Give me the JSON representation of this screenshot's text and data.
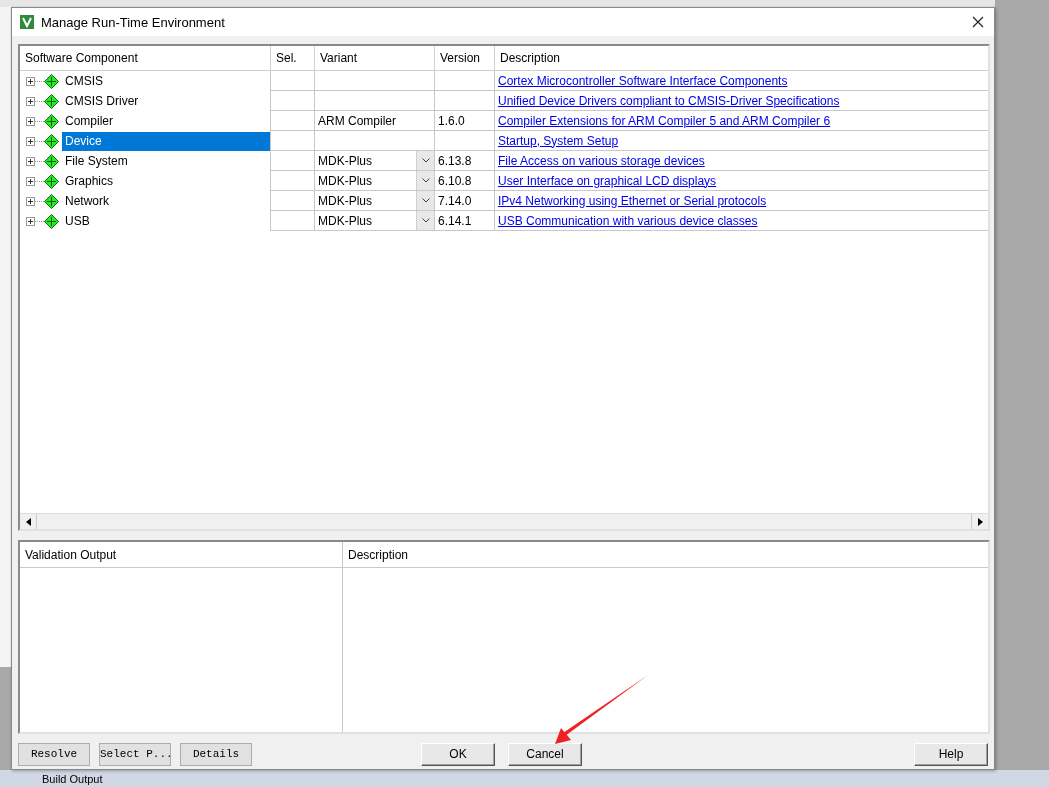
{
  "window": {
    "title": "Manage Run-Time Environment"
  },
  "table": {
    "columns": [
      "Software Component",
      "Sel.",
      "Variant",
      "Version",
      "Description"
    ],
    "rows": [
      {
        "name": "CMSIS",
        "selected": false,
        "kind": "text",
        "variant": "",
        "version": "",
        "description": "Cortex Microcontroller Software Interface Components"
      },
      {
        "name": "CMSIS Driver",
        "selected": false,
        "kind": "text",
        "variant": "",
        "version": "",
        "description": "Unified Device Drivers compliant to CMSIS-Driver Specifications"
      },
      {
        "name": "Compiler",
        "selected": false,
        "kind": "text",
        "variant": "ARM Compiler",
        "version": "1.6.0",
        "description": "Compiler Extensions for ARM Compiler 5 and ARM Compiler 6"
      },
      {
        "name": "Device",
        "selected": true,
        "kind": "text",
        "variant": "",
        "version": "",
        "description": "Startup, System Setup"
      },
      {
        "name": "File System",
        "selected": false,
        "kind": "dropdown",
        "variant": "MDK-Plus",
        "version": "6.13.8",
        "description": "File Access on various storage devices"
      },
      {
        "name": "Graphics",
        "selected": false,
        "kind": "dropdown",
        "variant": "MDK-Plus",
        "version": "6.10.8",
        "description": "User Interface on graphical LCD displays"
      },
      {
        "name": "Network",
        "selected": false,
        "kind": "dropdown",
        "variant": "MDK-Plus",
        "version": "7.14.0",
        "description": "IPv4 Networking using Ethernet or Serial protocols"
      },
      {
        "name": "USB",
        "selected": false,
        "kind": "dropdown",
        "variant": "MDK-Plus",
        "version": "6.14.1",
        "description": "USB Communication with various device classes"
      }
    ]
  },
  "validation": {
    "columns": [
      "Validation Output",
      "Description"
    ]
  },
  "left_buttons": [
    "Resolve",
    "Select P...",
    "Details"
  ],
  "center_buttons": [
    "OK",
    "Cancel"
  ],
  "help_button": "Help",
  "background": {
    "output_tab": "Build Output"
  },
  "annotation": {
    "kind": "arrow"
  }
}
